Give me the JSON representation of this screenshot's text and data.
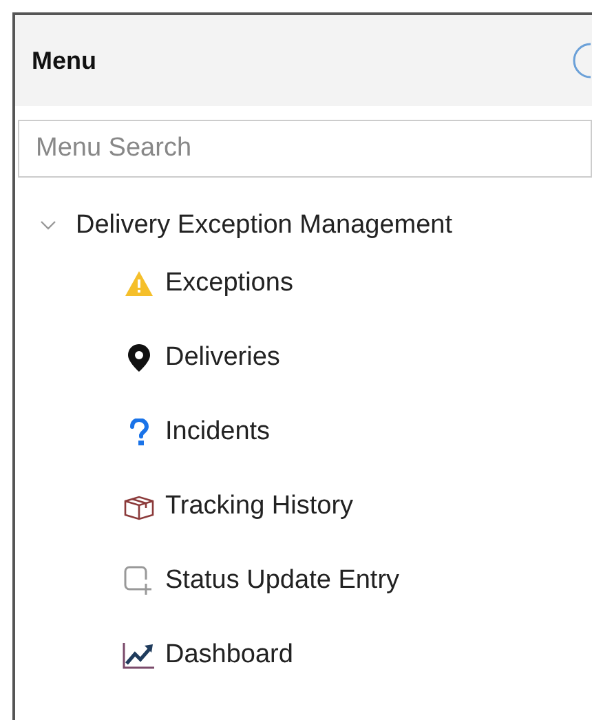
{
  "panel": {
    "title": "Menu"
  },
  "search": {
    "placeholder": "Menu Search"
  },
  "tree": [
    {
      "label": "Delivery Exception Management",
      "expanded": true,
      "children": [
        {
          "label": "Exceptions",
          "kind": "warning"
        },
        {
          "label": "Deliveries",
          "kind": "pin"
        },
        {
          "label": "Incidents",
          "kind": "question"
        },
        {
          "label": "Tracking History",
          "kind": "box"
        },
        {
          "label": "Status Update Entry",
          "kind": "add"
        },
        {
          "label": "Dashboard",
          "kind": "chart"
        }
      ]
    }
  ]
}
